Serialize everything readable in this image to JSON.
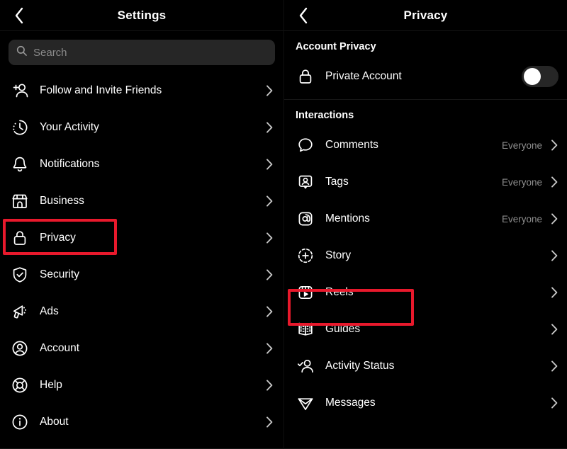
{
  "theme": {
    "background": "#000000",
    "text_primary": "#ffffff",
    "text_secondary": "#8e8e8e",
    "search_background": "#262626",
    "highlight_color": "#e8192c",
    "divider": "#161616"
  },
  "left_panel": {
    "header": {
      "title": "Settings",
      "back_icon": "chevron-left-icon"
    },
    "search": {
      "placeholder": "Search",
      "value": "",
      "icon": "search-icon"
    },
    "items": [
      {
        "label": "Follow and Invite Friends",
        "icon": "add-person-icon",
        "chevron": "›",
        "highlighted": false
      },
      {
        "label": "Your Activity",
        "icon": "clock-icon",
        "chevron": "›",
        "highlighted": false
      },
      {
        "label": "Notifications",
        "icon": "bell-icon",
        "chevron": "›",
        "highlighted": false
      },
      {
        "label": "Business",
        "icon": "storefront-icon",
        "chevron": "›",
        "highlighted": false
      },
      {
        "label": "Privacy",
        "icon": "lock-icon",
        "chevron": "›",
        "highlighted": true
      },
      {
        "label": "Security",
        "icon": "shield-check-icon",
        "chevron": "›",
        "highlighted": false
      },
      {
        "label": "Ads",
        "icon": "megaphone-icon",
        "chevron": "›",
        "highlighted": false
      },
      {
        "label": "Account",
        "icon": "account-circle-icon",
        "chevron": "›",
        "highlighted": false
      },
      {
        "label": "Help",
        "icon": "lifebuoy-icon",
        "chevron": "›",
        "highlighted": false
      },
      {
        "label": "About",
        "icon": "info-circle-icon",
        "chevron": "›",
        "highlighted": false
      }
    ]
  },
  "right_panel": {
    "header": {
      "title": "Privacy",
      "back_icon": "chevron-left-icon"
    },
    "sections": [
      {
        "title": "Account Privacy",
        "items": [
          {
            "label": "Private Account",
            "icon": "lock-icon",
            "control": "toggle",
            "toggle_on": false,
            "highlighted": false
          }
        ]
      },
      {
        "title": "Interactions",
        "items": [
          {
            "label": "Comments",
            "icon": "comment-bubble-icon",
            "value": "Everyone",
            "control": "chevron",
            "highlighted": false
          },
          {
            "label": "Tags",
            "icon": "tag-person-icon",
            "value": "Everyone",
            "control": "chevron",
            "highlighted": false
          },
          {
            "label": "Mentions",
            "icon": "at-sign-icon",
            "value": "Everyone",
            "control": "chevron",
            "highlighted": false
          },
          {
            "label": "Story",
            "icon": "story-plus-icon",
            "value": "",
            "control": "chevron",
            "highlighted": false
          },
          {
            "label": "Reels",
            "icon": "reels-icon",
            "value": "",
            "control": "chevron",
            "highlighted": true
          },
          {
            "label": "Guides",
            "icon": "guides-book-icon",
            "value": "",
            "control": "chevron",
            "highlighted": false
          },
          {
            "label": "Activity Status",
            "icon": "person-check-icon",
            "value": "",
            "control": "chevron",
            "highlighted": false
          },
          {
            "label": "Messages",
            "icon": "paper-plane-icon",
            "value": "",
            "control": "chevron",
            "highlighted": false
          }
        ]
      }
    ]
  }
}
